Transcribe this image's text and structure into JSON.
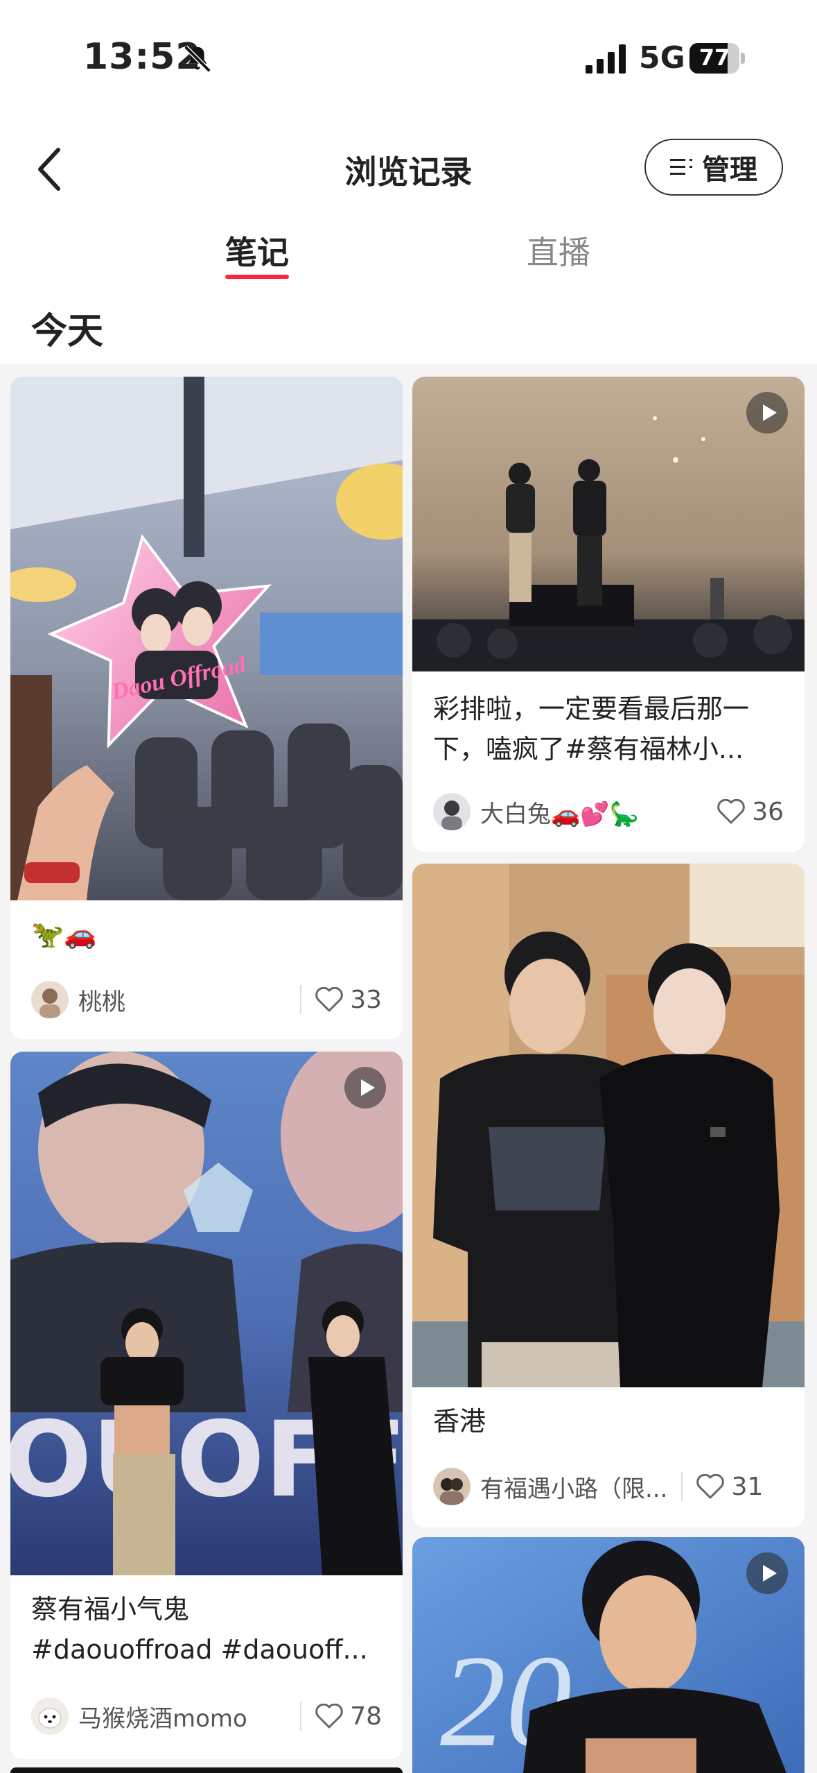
{
  "status_bar": {
    "time": "13:52",
    "network": "5G",
    "battery": "77",
    "battery_level": 0.77
  },
  "header": {
    "title": "浏览记录",
    "manage_label": "管理"
  },
  "tabs": [
    {
      "label": "笔记",
      "active": true
    },
    {
      "label": "直播",
      "active": false
    }
  ],
  "section": {
    "title": "今天"
  },
  "accent_color": "#ff2442",
  "notes": [
    {
      "title": "🦖🚗",
      "author": "桃桃",
      "likes": "33",
      "is_video": false,
      "sign_text": "Daou Offroad"
    },
    {
      "title_line1": "彩排啦，一定要看最后那一",
      "title_line2": "下，嗑疯了#蔡有福林小...",
      "author": "大白兔🚗💕🦕",
      "likes": "36",
      "is_video": true
    },
    {
      "title": "香港",
      "author": "有福遇小路（限...",
      "likes": "31",
      "is_video": false
    },
    {
      "title_line1": "蔡有福小气鬼",
      "title_line2": "#daouoffroad #daouoff...",
      "author": "马猴烧酒momo",
      "likes": "78",
      "is_video": true,
      "backdrop_text": "OUOFFR"
    },
    {
      "is_video": true,
      "backdrop_text": "20"
    }
  ]
}
